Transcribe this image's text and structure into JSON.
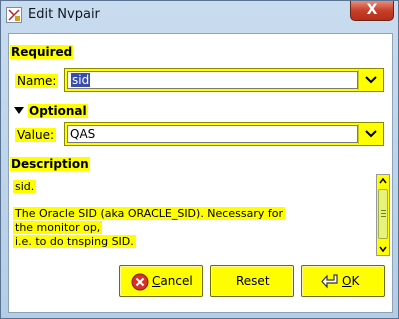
{
  "window": {
    "title": "Edit Nvpair",
    "close_glyph": "X"
  },
  "required": {
    "heading": "Required",
    "name_label": "Name:",
    "name_value": "sid"
  },
  "optional": {
    "heading": "Optional",
    "value_label": "Value:",
    "value_value": "QAS"
  },
  "description": {
    "heading": "Description",
    "lines": [
      "sid.",
      "",
      "The Oracle SID (aka ORACLE_SID). Necessary for",
      "the monitor op,",
      "i.e. to do tnsping SID."
    ]
  },
  "buttons": {
    "cancel_label_u": "C",
    "cancel_label_rest": "ancel",
    "reset_label": "Reset",
    "ok_label_u": "O",
    "ok_label_rest": "K"
  },
  "colors": {
    "highlight": "#fefe00",
    "selection": "#3a4da8"
  },
  "icons": {
    "app": "app-window-icon",
    "dropdown": "chevron-down-icon",
    "expander": "triangle-down-icon",
    "cancel": "cancel-x-icon",
    "ok": "ok-arrow-icon"
  }
}
